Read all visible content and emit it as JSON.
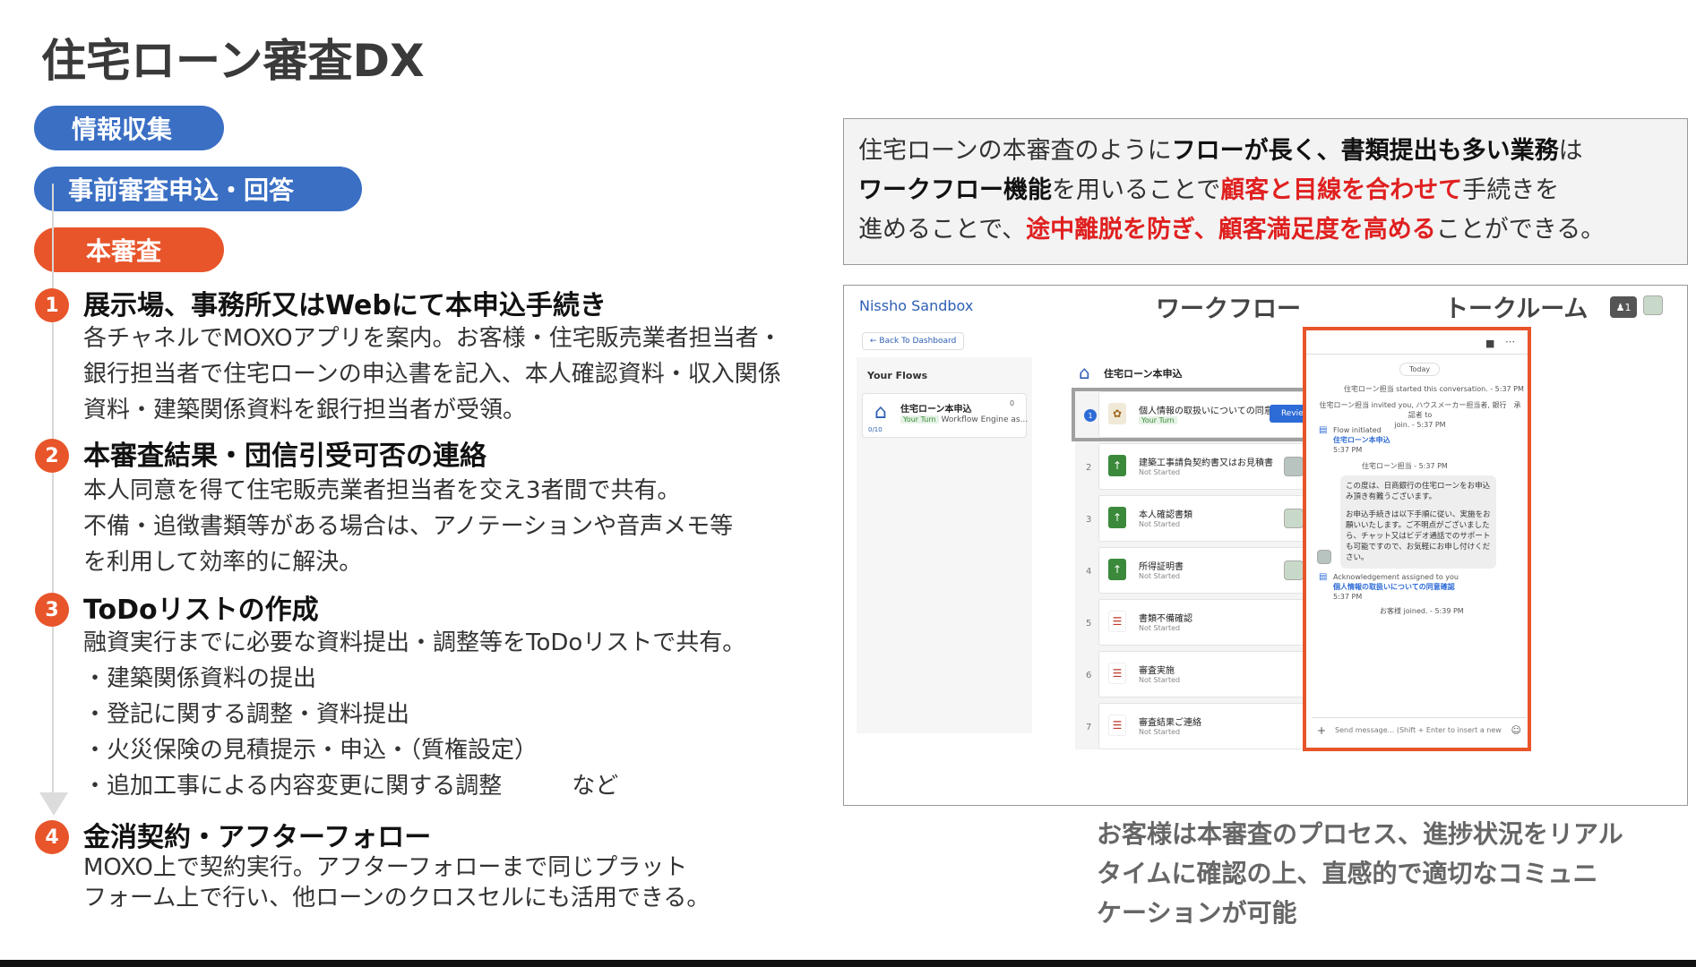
{
  "title": "住宅ローン審査DX",
  "phases": [
    "情報収集",
    "事前審査申込・回答",
    "本審査"
  ],
  "steps": [
    {
      "num": "1",
      "heading": "展示場、事務所又はWebにて本申込手続き",
      "lines": [
        "各チャネルでMOXOアプリを案内。お客様・住宅販売業者担当者・",
        "銀行担当者で住宅ローンの申込書を記入、本人確認資料・収入関係",
        "資料・建築関係資料を銀行担当者が受領。"
      ]
    },
    {
      "num": "2",
      "heading": "本審査結果・団信引受可否の連絡",
      "lines": [
        "本人同意を得て住宅販売業者担当者を交え3者間で共有。",
        "不備・追徴書類等がある場合は、アノテーションや音声メモ等",
        "を利用して効率的に解決。"
      ]
    },
    {
      "num": "3",
      "heading": "ToDoリストの作成",
      "lines": [
        "融資実行までに必要な資料提出・調整等をToDoリストで共有。",
        "・建築関係資料の提出",
        "・登記に関する調整・資料提出",
        "・火災保険の見積提示・申込・（質権設定）",
        "・追加工事による内容変更に関する調整　　　など"
      ]
    },
    {
      "num": "4",
      "heading": "金消契約・アフターフォロー",
      "lines": [
        "MOXO上で契約実行。アフターフォローまで同じプラット",
        "フォーム上で行い、他ローンのクロスセルにも活用できる。"
      ]
    }
  ],
  "summary": {
    "l1a": "住宅ローンの本審査のように",
    "l1b": "フローが長く、書類提出も多い業務",
    "l1c": "は",
    "l2a": "ワークフロー機能",
    "l2b": "を用いることで",
    "l2c": "顧客と目線を合わせて",
    "l2d": "手続きを",
    "l3a": "進めることで、",
    "l3b": "途中離脱を防ぎ、顧客満足度を高める",
    "l3c": "ことができる。"
  },
  "app": {
    "brand": "Nissho Sandbox",
    "workflow_label": "ワークフロー",
    "talkroom_label": "トークルーム",
    "bell_count": "1",
    "back": "← Back To Dashboard",
    "your_flows": "Your Flows",
    "flow_name": "住宅ローン本申込",
    "flow_turn": "Your Turn",
    "flow_engine": "Workflow Engine as...",
    "flow_count": "0",
    "flow_progress": "0/10",
    "wf_title": "住宅ローン本申込",
    "wf_steps": [
      {
        "n": "1",
        "name": "個人情報の取扱いについての同意確認",
        "status": "Your Turn",
        "action": "Review"
      },
      {
        "n": "2",
        "name": "建築工事請負契約書又はお見積書",
        "status": "Not Started"
      },
      {
        "n": "3",
        "name": "本人確認書類",
        "status": "Not Started"
      },
      {
        "n": "4",
        "name": "所得証明書",
        "status": "Not Started"
      },
      {
        "n": "5",
        "name": "書類不備確認",
        "status": "Not Started"
      },
      {
        "n": "6",
        "name": "審査実施",
        "status": "Not Started"
      },
      {
        "n": "7",
        "name": "審査結果ご連絡",
        "status": "Not Started"
      }
    ],
    "chat": {
      "today": "Today",
      "m1": "住宅ローン担当 started this conversation. - 5:37 PM",
      "m2a": "住宅ローン担当 invited you, ハウスメーカー担当者, 銀行　承認者 to",
      "m2b": "join. - 5:37 PM",
      "flow_init": "Flow initiated",
      "flow_link": "住宅ローン本申込",
      "flow_time": "5:37 PM",
      "sender": "住宅ローン担当 - 5:37 PM",
      "bubble1": "この度は、日商銀行の住宅ローンをお申込み頂き有難うございます。",
      "bubble2": "お申込手続きは以下手順に従い、実施をお願いいたします。ご不明点がございましたら、チャット又はビデオ通話でのサポートも可能ですので、お気軽にお申し付けください。",
      "ack": "Acknowledgement assigned to you",
      "ack_link": "個人情報の取扱いについての同意確認",
      "ack_time": "5:37 PM",
      "joined": "お客様 joined. - 5:39 PM",
      "input_placeholder": "Send message... (Shift + Enter to insert a new"
    }
  },
  "caption": [
    "お客様は本審査のプロセス、進捗状況をリアル",
    "タイムに確認の上、直感的で適切なコミュニ",
    "ケーションが可能"
  ]
}
